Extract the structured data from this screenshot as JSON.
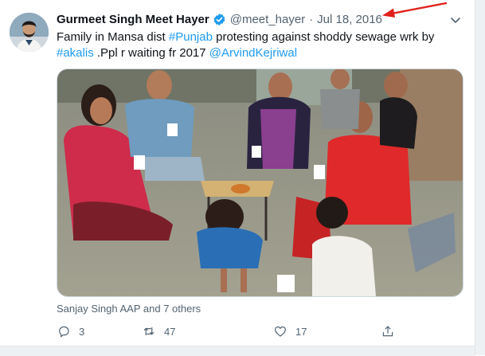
{
  "tweet": {
    "author_name": "Gurmeet Singh Meet Hayer",
    "handle": "@meet_hayer",
    "separator": "·",
    "date": "Jul 18, 2016",
    "text_prefix": "Family in Mansa dist ",
    "hashtag_punjab": "#Punjab",
    "text_middle": " protesting against shoddy sewage wrk by ",
    "hashtag_akalis": "#akalis",
    "text_suffix": " .Ppl r waiting fr 2017 ",
    "mention": "@ArvindKejriwal",
    "social_context": "Sanjay Singh AAP and 7 others"
  },
  "actions": {
    "reply_count": "3",
    "retweet_count": "47",
    "like_count": "17"
  },
  "icons": {
    "verified": "verified-badge-icon",
    "more": "chevron-down-icon",
    "reply": "reply-icon",
    "retweet": "retweet-icon",
    "like": "heart-icon",
    "share": "share-icon",
    "annotation": "red-arrow"
  },
  "colors": {
    "link": "#1d9bf0",
    "muted": "#536471",
    "annotation_arrow": "#e0211b"
  }
}
